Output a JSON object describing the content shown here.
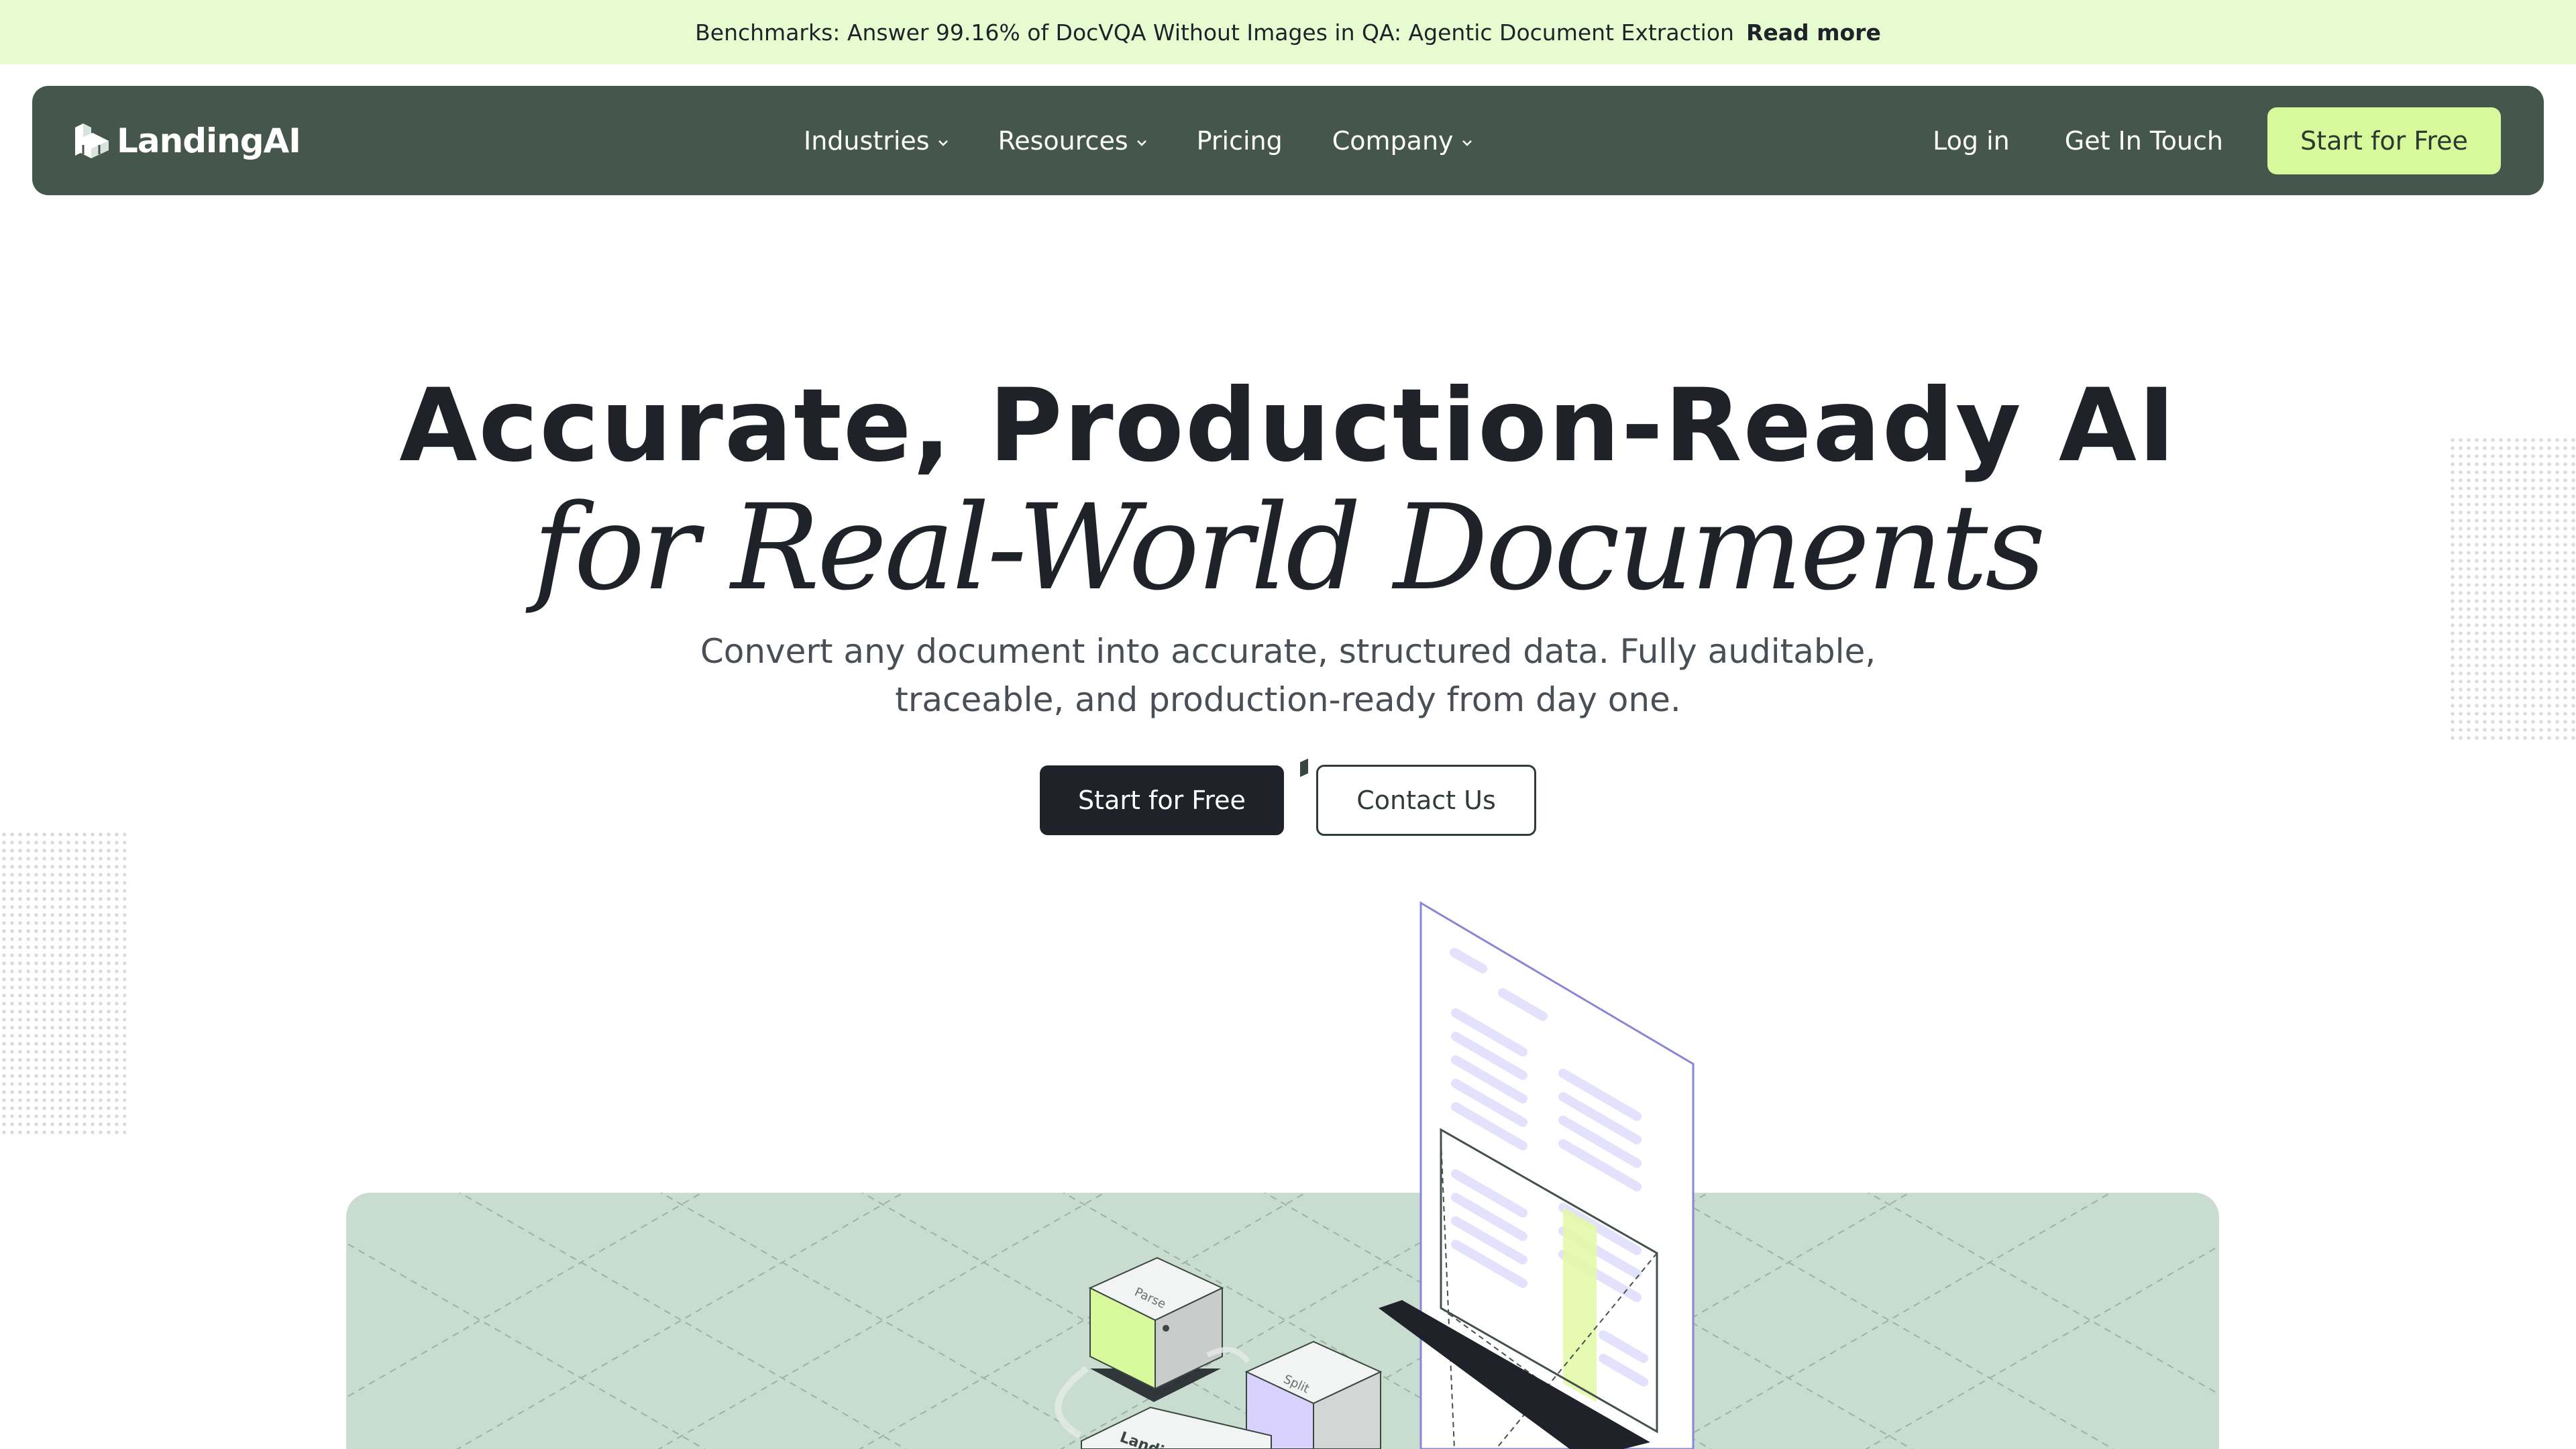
{
  "banner": {
    "text": "Benchmarks: Answer 99.16% of DocVQA Without Images in QA: Agentic Document Extraction",
    "link": "Read more"
  },
  "nav": {
    "logo": "LandingAI",
    "items": [
      {
        "label": "Industries",
        "dropdown": true
      },
      {
        "label": "Resources",
        "dropdown": true
      },
      {
        "label": "Pricing",
        "dropdown": false
      },
      {
        "label": "Company",
        "dropdown": true
      }
    ],
    "login": "Log in",
    "contact": "Get In Touch",
    "cta": "Start for Free"
  },
  "hero": {
    "title": "Accurate, Production-Ready AI",
    "subtitle": "for Real-World Documents",
    "description": "Convert any document into accurate, structured data. Fully auditable, traceable, and production-ready from day one.",
    "primary_button": "Start for Free",
    "secondary_button": "Contact Us"
  },
  "illustration": {
    "cube_labels": [
      "Parse",
      "Split",
      "Landi"
    ]
  },
  "colors": {
    "banner_bg": "#e6fbd0",
    "nav_bg": "#45574d",
    "nav_cta_bg": "#d8f89c",
    "text_dark": "#1f2329",
    "stage_bg": "#c8ddd0",
    "accent_lime": "#d8f89c",
    "accent_lavender": "#d9d2ff"
  }
}
